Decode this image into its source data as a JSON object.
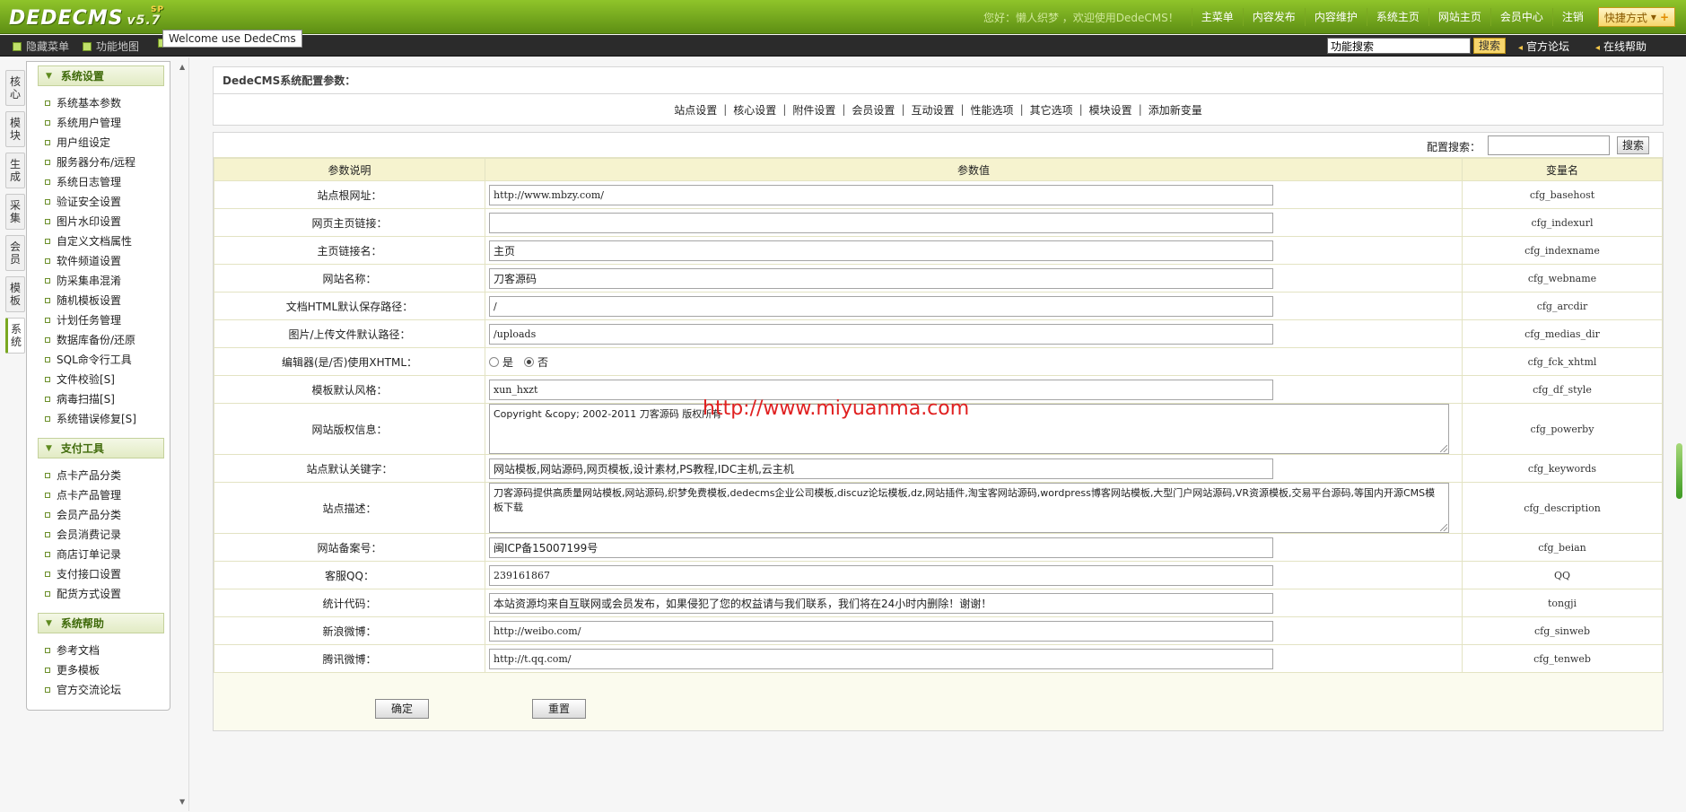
{
  "app": {
    "logo_text": "DEDECMS",
    "version": "v5.7",
    "version_badge": "SP",
    "greeting": "您好：懒人织梦 ，欢迎使用DedeCMS！",
    "nav": [
      "主菜单",
      "内容发布",
      "内容维护",
      "系统主页",
      "网站主页",
      "会员中心",
      "注销"
    ],
    "quick_label": "快捷方式",
    "tooltip": "Welcome use DedeCms"
  },
  "subbar": {
    "hide_menu": "隐藏菜单",
    "function_map": "功能地图",
    "search_value": "功能搜索",
    "search_button": "搜索",
    "forum_link": "官方论坛",
    "help_link": "在线帮助"
  },
  "vtabs": [
    "核心",
    "模块",
    "生成",
    "采集",
    "会员",
    "模板",
    "系统"
  ],
  "menu": {
    "sections": [
      {
        "title": "系统设置",
        "items": [
          "系统基本参数",
          "系统用户管理",
          "用户组设定",
          "服务器分布/远程",
          "系统日志管理",
          "验证安全设置",
          "图片水印设置",
          "自定义文档属性",
          "软件频道设置",
          "防采集串混淆",
          "随机模板设置",
          "计划任务管理",
          "数据库备份/还原",
          "SQL命令行工具",
          "文件校验[S]",
          "病毒扫描[S]",
          "系统错误修复[S]"
        ]
      },
      {
        "title": "支付工具",
        "items": [
          "点卡产品分类",
          "点卡产品管理",
          "会员产品分类",
          "会员消费记录",
          "商店订单记录",
          "支付接口设置",
          "配货方式设置"
        ]
      },
      {
        "title": "系统帮助",
        "items": [
          "参考文档",
          "更多模板",
          "官方交流论坛"
        ]
      }
    ]
  },
  "main": {
    "header_title": "DedeCMS系统配置参数：",
    "tabs": [
      "站点设置",
      "核心设置",
      "附件设置",
      "会员设置",
      "互动设置",
      "性能选项",
      "其它选项",
      "模块设置",
      "添加新变量"
    ],
    "search_label": "配置搜索：",
    "search_value": "",
    "search_button": "搜索",
    "columns": [
      "参数说明",
      "参数值",
      "变量名"
    ],
    "rows": [
      {
        "label": "站点根网址：",
        "value": "http://www.mbzy.com/",
        "var": "cfg_basehost"
      },
      {
        "label": "网页主页链接：",
        "value": "",
        "var": "cfg_indexurl"
      },
      {
        "label": "主页链接名：",
        "value": "主页",
        "var": "cfg_indexname"
      },
      {
        "label": "网站名称：",
        "value": "刀客源码",
        "var": "cfg_webname"
      },
      {
        "label": "文档HTML默认保存路径：",
        "value": "/",
        "var": "cfg_arcdir"
      },
      {
        "label": "图片/上传文件默认路径：",
        "value": "/uploads",
        "var": "cfg_medias_dir"
      },
      {
        "label": "编辑器(是/否)使用XHTML：",
        "radio_yes": "是",
        "radio_no": "否",
        "selected": "否",
        "var": "cfg_fck_xhtml"
      },
      {
        "label": "模板默认风格：",
        "value": "xun_hxzt",
        "var": "cfg_df_style"
      },
      {
        "label": "网站版权信息：",
        "value": "Copyright &copy; 2002-2011 刀客源码 版权所有",
        "var": "cfg_powerby"
      },
      {
        "label": "站点默认关键字：",
        "value": "网站模板,网站源码,网页模板,设计素材,PS教程,IDC主机,云主机",
        "var": "cfg_keywords"
      },
      {
        "label": "站点描述：",
        "value": "刀客源码提供高质量网站模板,网站源码,织梦免费模板,dedecms企业公司模板,discuz论坛模板,dz,网站插件,淘宝客网站源码,wordpress博客网站模板,大型门户网站源码,VR资源模板,交易平台源码,等国内开源CMS模板下载",
        "var": "cfg_description"
      },
      {
        "label": "网站备案号：",
        "value": "闽ICP备15007199号",
        "var": "cfg_beian"
      },
      {
        "label": "客服QQ：",
        "value": "239161867",
        "var": "QQ"
      },
      {
        "label": "统计代码：",
        "value": "本站资源均来自互联网或会员发布，如果侵犯了您的权益请与我们联系，我们将在24小时内删除！谢谢！",
        "var": "tongji"
      },
      {
        "label": "新浪微博：",
        "value": "http://weibo.com/",
        "var": "cfg_sinweb"
      },
      {
        "label": "腾讯微博：",
        "value": "http://t.qq.com/",
        "var": "cfg_tenweb"
      }
    ],
    "confirm_button": "确定",
    "reset_button": "重置"
  },
  "watermark": "http://www.miyuanma.com",
  "colors": {
    "topbar": "#6fa31b",
    "accent_green": "#5f8b1f",
    "header_row": "#f6f3cf",
    "watermark": "#e02020"
  }
}
